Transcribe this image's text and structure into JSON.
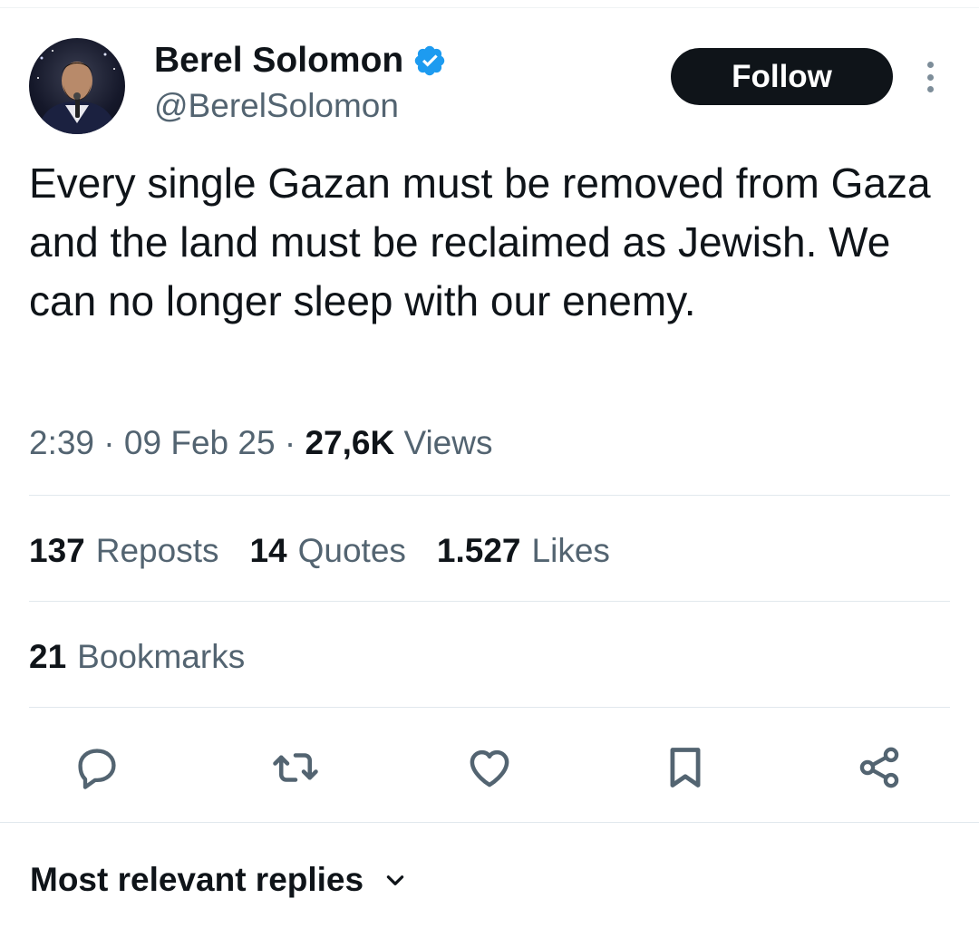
{
  "author": {
    "display_name": "Berel Solomon",
    "handle": "@BerelSolomon",
    "verified": true
  },
  "follow_button": {
    "label": "Follow"
  },
  "tweet": {
    "text": "Every single Gazan must be removed from Gaza and the land must be reclaimed as Jewish. We can no longer sleep with our enemy.",
    "time": "2:39",
    "sep1": " · ",
    "date": "09 Feb 25",
    "sep2": " · ",
    "views_count": "27,6K",
    "views_label": "Views"
  },
  "stats": {
    "reposts": {
      "count": "137",
      "label": "Reposts"
    },
    "quotes": {
      "count": "14",
      "label": "Quotes"
    },
    "likes": {
      "count": "1.527",
      "label": "Likes"
    },
    "bookmarks": {
      "count": "21",
      "label": "Bookmarks"
    }
  },
  "actions": [
    "reply-icon",
    "repost-icon",
    "like-icon",
    "bookmark-icon",
    "share-icon"
  ],
  "replies_sort": {
    "label": "Most relevant replies"
  },
  "colors": {
    "text_primary": "#0f1419",
    "text_secondary": "#536471",
    "verified_blue": "#1d9bf0",
    "button_bg": "#0f1419",
    "divider": "#e1e8ed"
  }
}
